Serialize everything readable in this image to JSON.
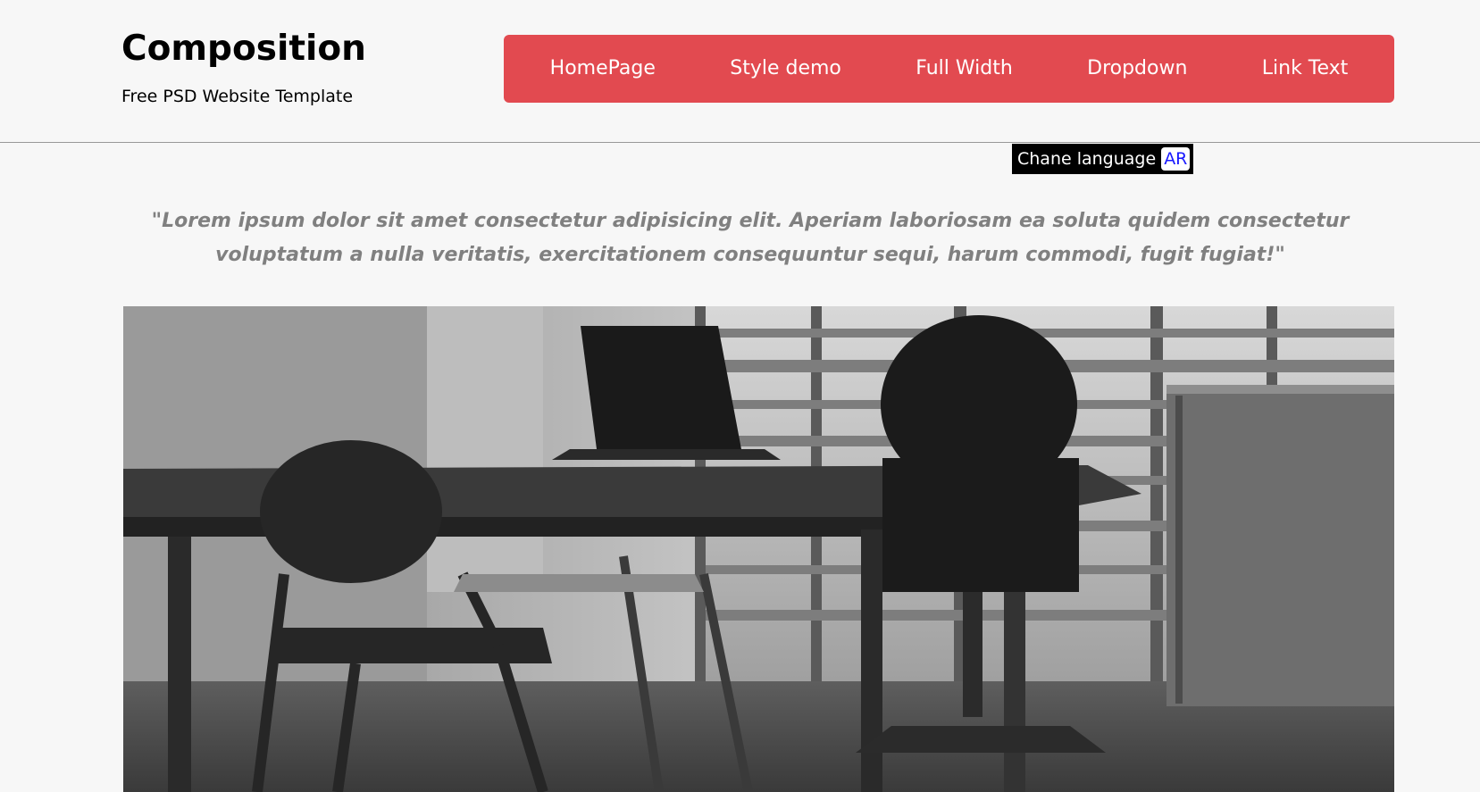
{
  "brand": {
    "title": "Composition",
    "subtitle": "Free PSD Website Template"
  },
  "nav": {
    "background_color": "#e24a50",
    "items": [
      {
        "label": "HomePage"
      },
      {
        "label": "Style demo"
      },
      {
        "label": "Full Width"
      },
      {
        "label": "Dropdown"
      },
      {
        "label": "Link Text"
      }
    ]
  },
  "language": {
    "label": "Chane language",
    "button_label": "AR"
  },
  "quote": {
    "text": "\"Lorem ipsum dolor sit amet consectetur adipisicing elit. Aperiam laboriosam ea soluta quidem consectetur voluptatum a nulla veritatis, exercitationem consequuntur sequi, harum commodi, fugit fugiat!\""
  },
  "hero_image": {
    "subject": "grayscale office photo with desk, laptop and chairs"
  }
}
